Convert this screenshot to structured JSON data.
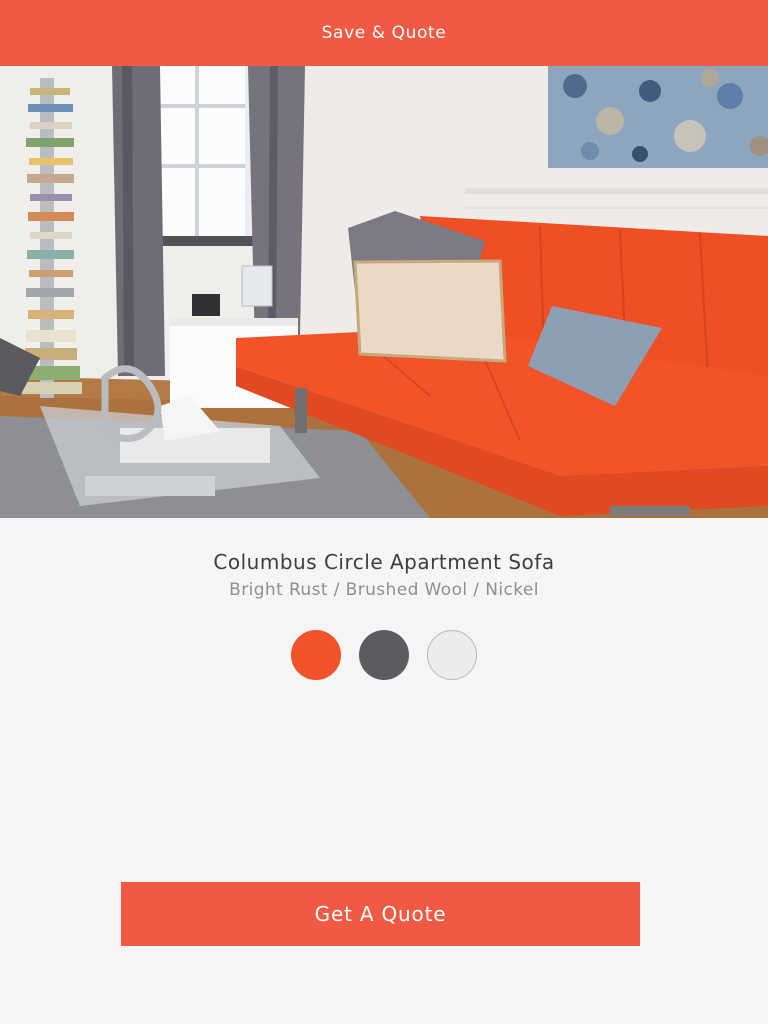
{
  "theme": {
    "accent": "#f05a45"
  },
  "header": {
    "title": "Save & Quote"
  },
  "hero": {
    "alt_subject": "orange sofa in living room"
  },
  "product": {
    "name": "Columbus Circle Apartment Sofa",
    "variant": "Bright Rust / Brushed Wool / Nickel"
  },
  "swatches": [
    {
      "name": "Bright Rust",
      "color": "#f0532c"
    },
    {
      "name": "Brushed Wool",
      "color": "#5c5c60"
    },
    {
      "name": "Nickel",
      "color": "#ececec"
    }
  ],
  "cta": {
    "label": "Get A Quote"
  }
}
